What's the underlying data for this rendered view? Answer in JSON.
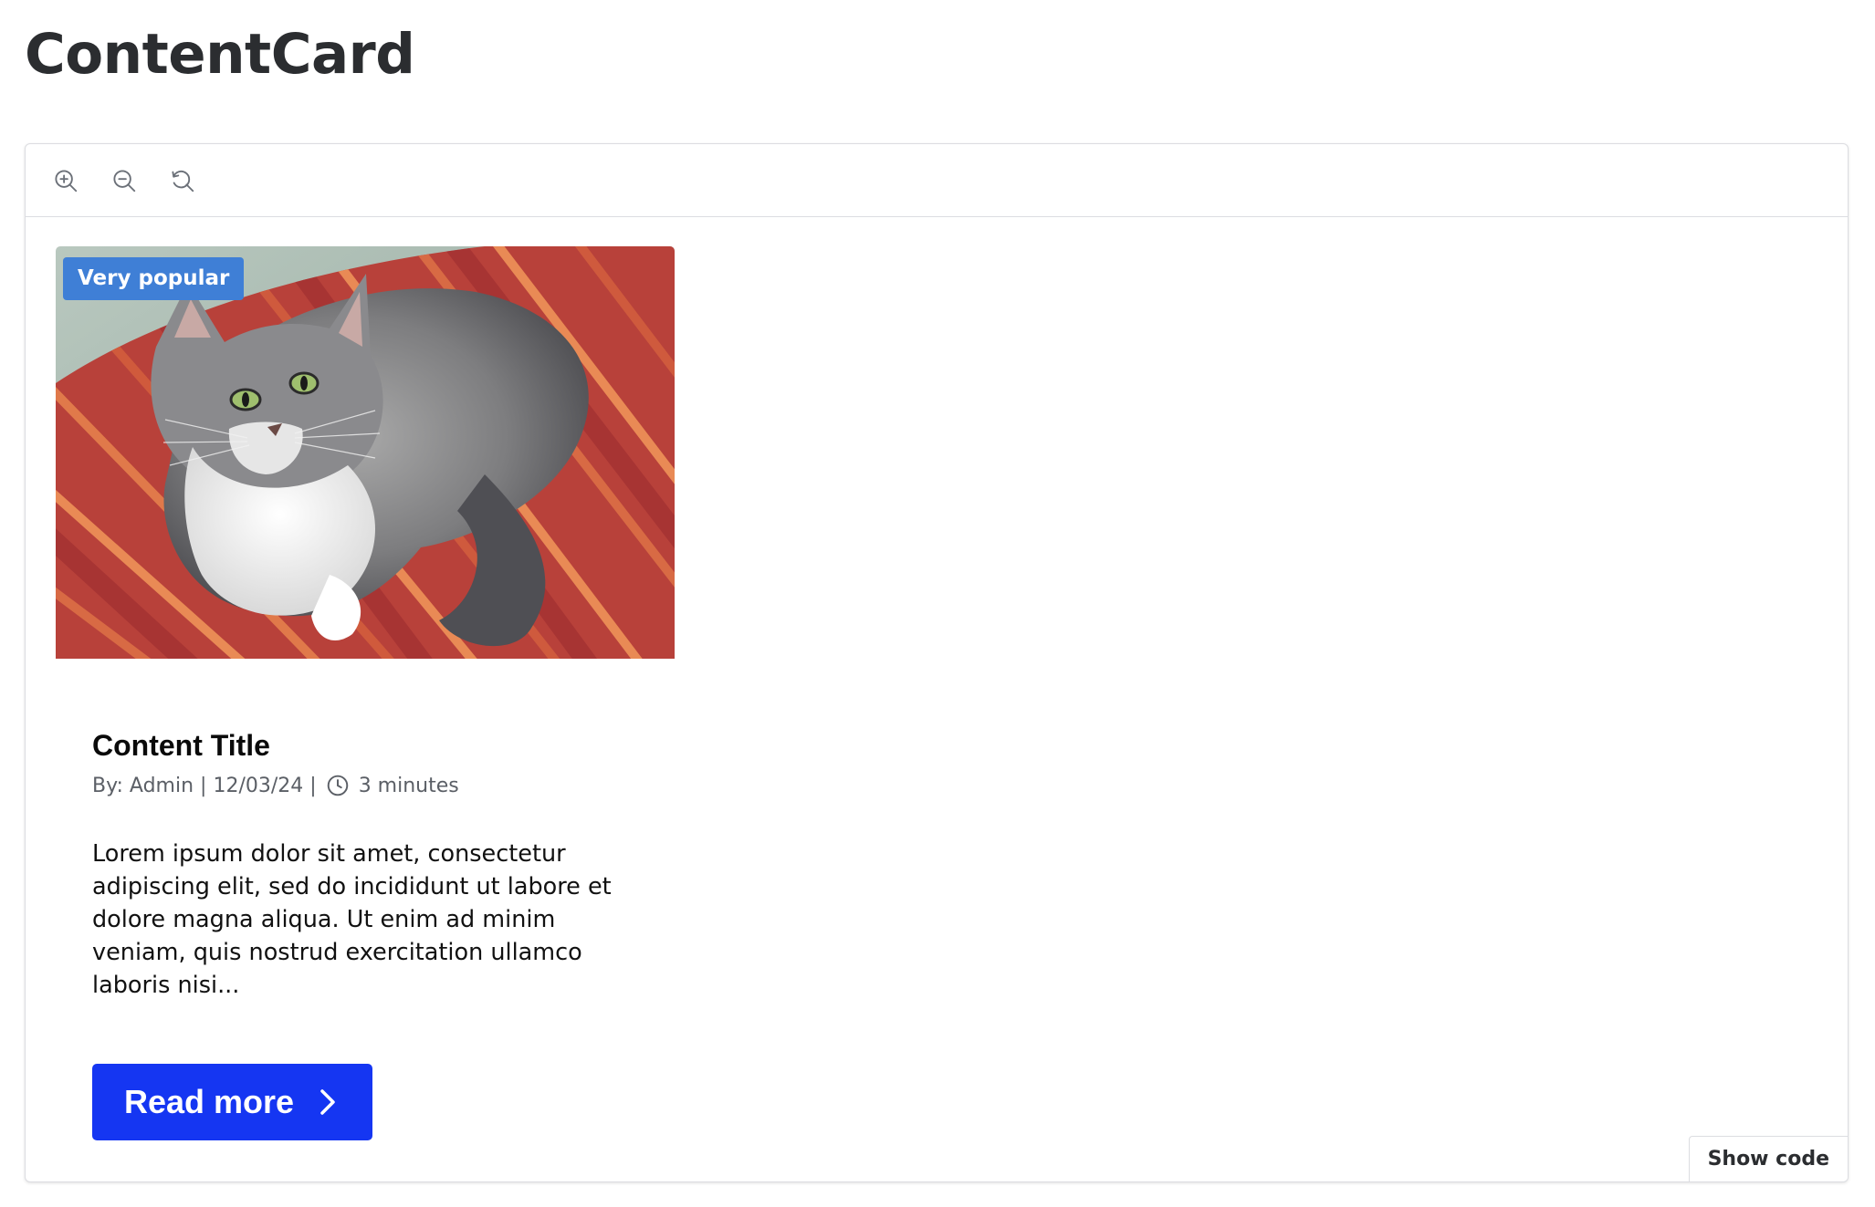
{
  "page": {
    "title": "ContentCard"
  },
  "toolbar": {
    "buttons": [
      {
        "icon": "zoom-in-icon"
      },
      {
        "icon": "zoom-out-icon"
      },
      {
        "icon": "reset-zoom-icon"
      }
    ]
  },
  "card": {
    "badge": "Very popular",
    "image": "cat-photo",
    "title": "Content Title",
    "meta": {
      "author": "By: Admin",
      "date": "12/03/24",
      "separator": "|",
      "read_time": "3 minutes",
      "icon": "clock-icon"
    },
    "excerpt": "Lorem ipsum dolor sit amet, consectetur adipiscing elit, sed do incididunt ut labore et dolore magna aliqua. Ut enim ad minim veniam, quis nostrud exercitation ullamco laboris nisi...",
    "cta_label": "Read more",
    "cta_icon": "chevron-right-icon"
  },
  "footer": {
    "show_code_label": "Show code"
  },
  "colors": {
    "badge": "#3f7fd6",
    "cta": "#1536f2",
    "border": "#dcdde1"
  }
}
